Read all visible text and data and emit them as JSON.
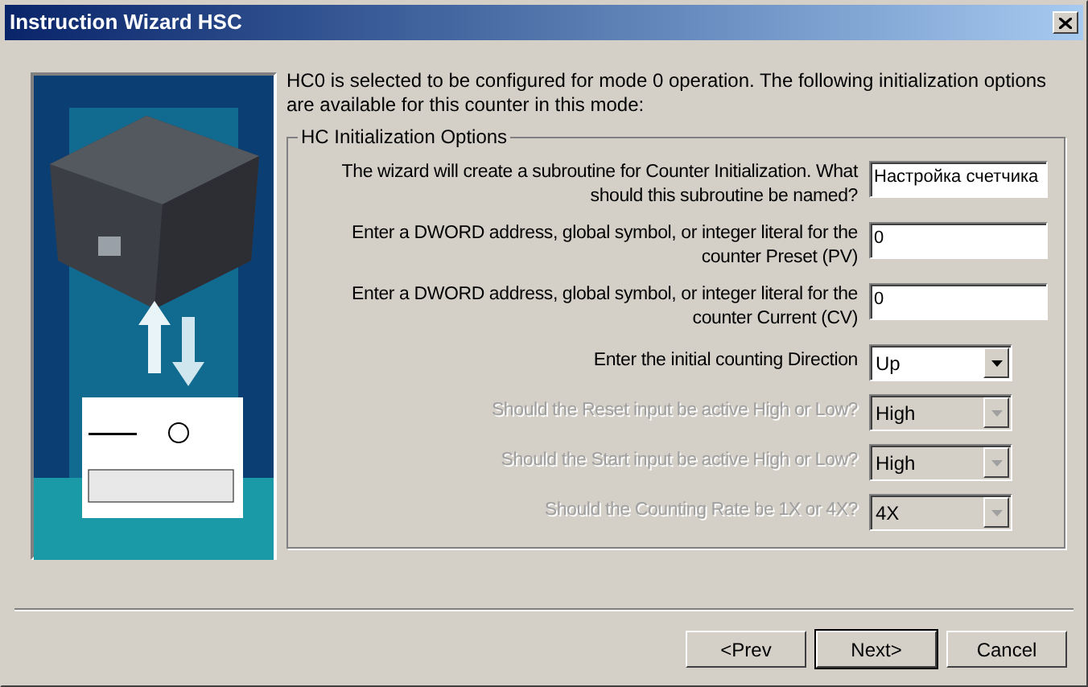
{
  "window": {
    "title": "Instruction Wizard HSC"
  },
  "intro": "HC0 is selected to be configured for mode 0 operation.  The following initialization options are available for this counter in this mode:",
  "group": {
    "title": "HC Initialization Options",
    "rows": [
      {
        "kind": "text",
        "label": "The wizard will create a subroutine for Counter Initialization.  What should this subroutine be named?",
        "value": "Настройка счетчика",
        "disabled": false
      },
      {
        "kind": "text",
        "label": "Enter a DWORD address, global symbol, or integer literal for the counter Preset (PV)",
        "value": "0",
        "disabled": false
      },
      {
        "kind": "text",
        "label": "Enter a DWORD address, global symbol, or integer literal for the counter Current (CV)",
        "value": "0",
        "disabled": false
      },
      {
        "kind": "combo",
        "label": "Enter the initial counting Direction",
        "value": "Up",
        "disabled": false
      },
      {
        "kind": "combo",
        "label": "Should the Reset input be active High or Low?",
        "value": "High",
        "disabled": true
      },
      {
        "kind": "combo",
        "label": "Should the Start input be active High or Low?",
        "value": "High",
        "disabled": true
      },
      {
        "kind": "combo",
        "label": "Should the Counting Rate be 1X or 4X?",
        "value": "4X",
        "disabled": true
      }
    ]
  },
  "buttons": [
    {
      "label": "<Prev",
      "default": false
    },
    {
      "label": "Next>",
      "default": true
    },
    {
      "label": "Cancel",
      "default": false
    }
  ]
}
